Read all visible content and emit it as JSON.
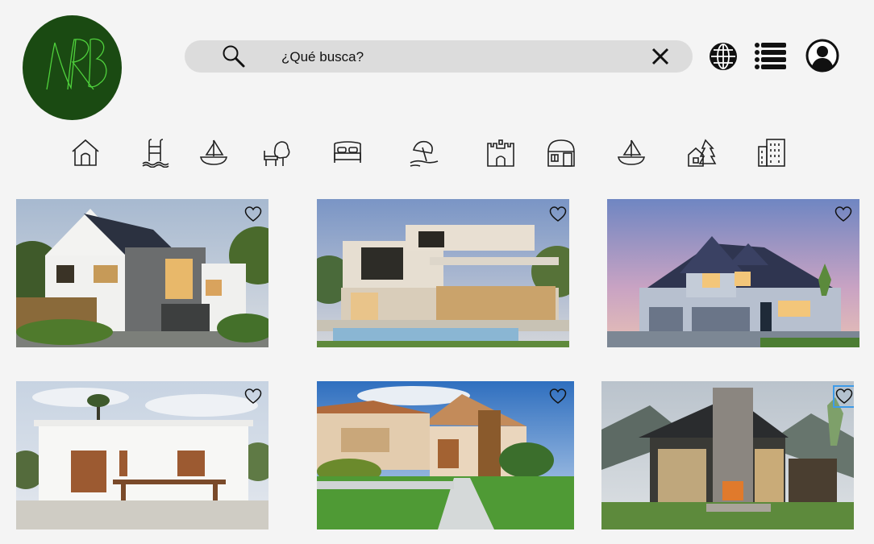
{
  "header": {
    "logo_text": "NRB",
    "logo_icon": "nrb-monogram-logo",
    "search": {
      "placeholder": "¿Qué busca?",
      "value": "",
      "search_icon": "search-icon",
      "clear_icon": "close-icon"
    },
    "actions": [
      {
        "icon": "globe-icon"
      },
      {
        "icon": "menu-list-icon"
      },
      {
        "icon": "user-account-icon"
      }
    ]
  },
  "categories": [
    {
      "icon": "house-icon"
    },
    {
      "icon": "pool-icon"
    },
    {
      "icon": "boat-icon"
    },
    {
      "icon": "countryside-icon"
    },
    {
      "icon": "bed-icon"
    },
    {
      "icon": "beach-icon"
    },
    {
      "icon": "castle-icon"
    },
    {
      "icon": "cabin-icon"
    },
    {
      "icon": "sailboat-icon"
    },
    {
      "icon": "forest-cabin-icon"
    },
    {
      "icon": "building-icon"
    }
  ],
  "listings": [
    {
      "image": "modern-house-solar-panels",
      "favorite_icon": "heart-icon",
      "favorited": false
    },
    {
      "image": "modern-villa-pool",
      "favorite_icon": "heart-icon",
      "favorited": false
    },
    {
      "image": "suburban-house-dusk",
      "favorite_icon": "heart-icon",
      "favorited": false
    },
    {
      "image": "white-mediterranean-house",
      "favorite_icon": "heart-icon",
      "favorited": false
    },
    {
      "image": "tropical-house-garden",
      "favorite_icon": "heart-icon",
      "favorited": false
    },
    {
      "image": "mountain-house-stone-chimney",
      "favorite_icon": "heart-icon",
      "favorited": false,
      "focused": true
    }
  ],
  "colors": {
    "background": "#f4f4f4",
    "logo_fill": "#1a4a12",
    "logo_stroke": "#4fd13c",
    "search_fill": "#dcdcdc",
    "focus_outline": "#3d9be9"
  }
}
